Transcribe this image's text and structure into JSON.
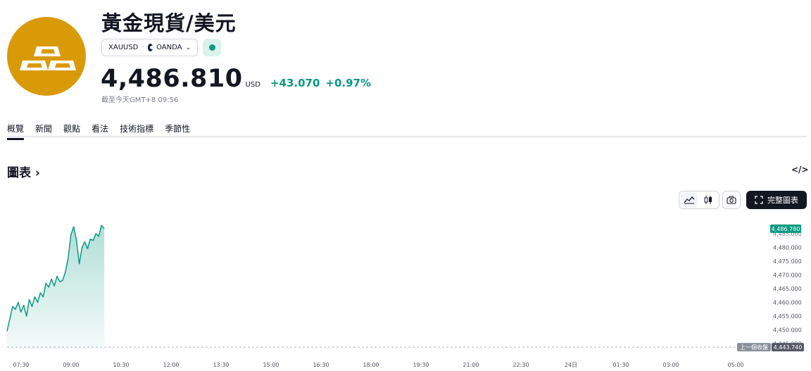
{
  "header": {
    "title": "黃金現貨/美元",
    "symbol": "XAUUSD",
    "exchange": "OANDA",
    "price": "4,486.810",
    "currency": "USD",
    "change": "+43.070",
    "change_percent": "+0.97%",
    "as_of": "截至今天GMT+8 09:56",
    "market_status": "open"
  },
  "tabs": [
    {
      "label": "概覽",
      "active": true
    },
    {
      "label": "新聞",
      "active": false
    },
    {
      "label": "觀點",
      "active": false
    },
    {
      "label": "看法",
      "active": false
    },
    {
      "label": "技術指標",
      "active": false
    },
    {
      "label": "季節性",
      "active": false
    }
  ],
  "chart_section": {
    "title": "圖表",
    "chevron": "›",
    "embed_icon": "code-icon",
    "fullscreen_label": "完整圖表"
  },
  "colors": {
    "accent": "#089981",
    "logo_bg": "#d99a08",
    "text": "#131722",
    "muted": "#787b86"
  },
  "chart_data": {
    "type": "area",
    "title": "",
    "xlabel": "",
    "ylabel": "",
    "x_ticks": [
      "07:30",
      "09:00",
      "10:30",
      "12:00",
      "13:30",
      "15:00",
      "16:30",
      "18:00",
      "19:30",
      "21:00",
      "22:30",
      "24日",
      "01:30",
      "03:00",
      "05:00"
    ],
    "y_ticks": [
      "4,480.000",
      "4,475.000",
      "4,470.000",
      "4,465.000",
      "4,460.000",
      "4,455.000",
      "4,450.000"
    ],
    "y_tick_values": [
      4480,
      4475,
      4470,
      4465,
      4460,
      4455,
      4450
    ],
    "ylim": [
      4443.0,
      4489.3
    ],
    "last_price_label": "4,486.780",
    "last_price": 4486.78,
    "prev_close_label": "上一個收盤",
    "prev_close_value_label": "4,443.740",
    "prev_close": 4443.74,
    "partial_labels": [
      "4,485.000",
      "4,445.000"
    ],
    "series": [
      {
        "x": [
          "07:00",
          "07:05",
          "07:10",
          "07:15",
          "07:20",
          "07:25",
          "07:30",
          "07:35",
          "07:40",
          "07:45",
          "07:50",
          "07:55",
          "08:00",
          "08:05",
          "08:10",
          "08:15",
          "08:20",
          "08:25",
          "08:30",
          "08:35",
          "08:40",
          "08:45",
          "08:50",
          "08:55",
          "09:00",
          "09:05",
          "09:10",
          "09:15",
          "09:20",
          "09:25",
          "09:30",
          "09:35",
          "09:40",
          "09:45",
          "09:50",
          "09:55"
        ],
        "values": [
          4449.5,
          4454.0,
          4458.5,
          4457.5,
          4460.0,
          4456.5,
          4459.0,
          4455.0,
          4461.0,
          4458.5,
          4462.0,
          4460.0,
          4463.5,
          4462.0,
          4467.0,
          4465.5,
          4468.5,
          4466.0,
          4469.5,
          4467.5,
          4468.0,
          4471.0,
          4476.0,
          4484.5,
          4487.5,
          4482.5,
          4474.0,
          4480.0,
          4482.0,
          4479.5,
          4483.0,
          4482.5,
          4485.0,
          4484.0,
          4488.0,
          4486.78
        ]
      }
    ]
  }
}
